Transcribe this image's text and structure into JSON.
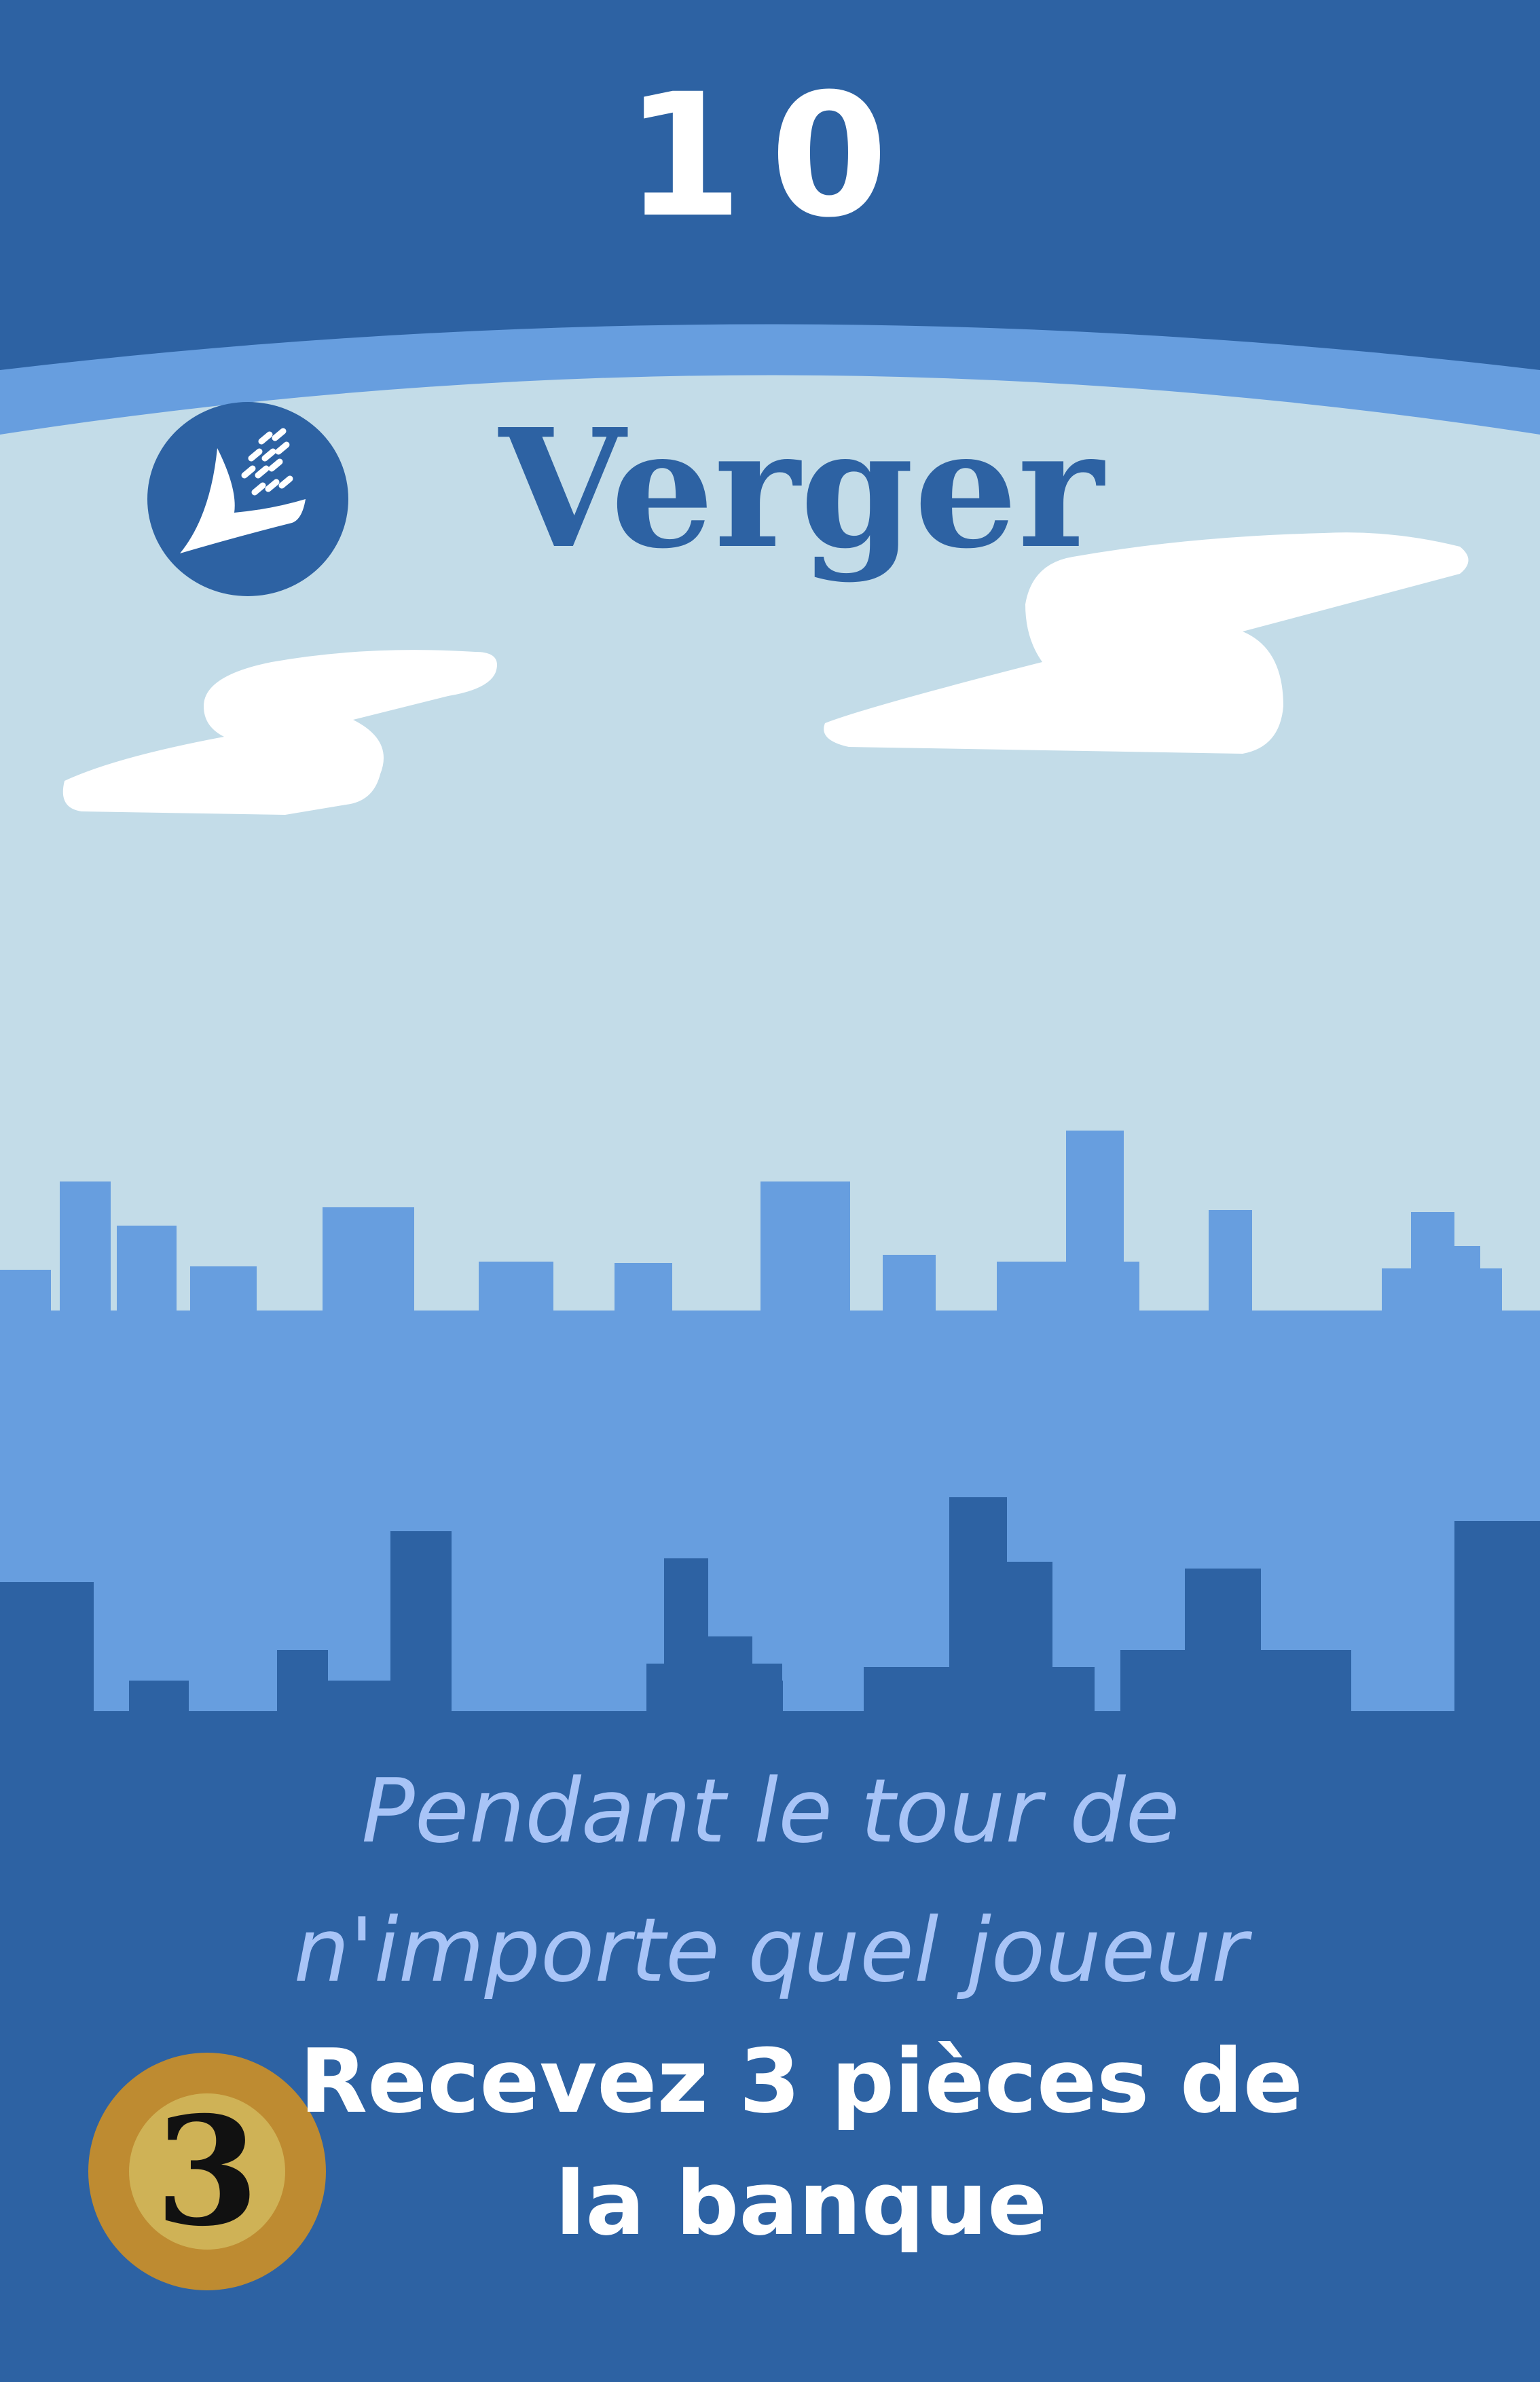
{
  "card": {
    "activation_number": "10",
    "name": "Verger",
    "type_icon": "wheat-icon",
    "trigger_text_line1": "Pendant le tour de",
    "trigger_text_line2": "n'importe quel joueur",
    "effect_text_line1": "Recevez 3 pièces de",
    "effect_text_line2": "la banque",
    "cost": "3"
  },
  "colors": {
    "card_blue": "#2d62a3",
    "sky": "#c3dce8",
    "band_light_blue": "#679edf",
    "cloud": "#ffffff",
    "coin_outer": "#be8b31",
    "coin_inner": "#cfb256",
    "trigger_text": "#a8c4f7"
  }
}
